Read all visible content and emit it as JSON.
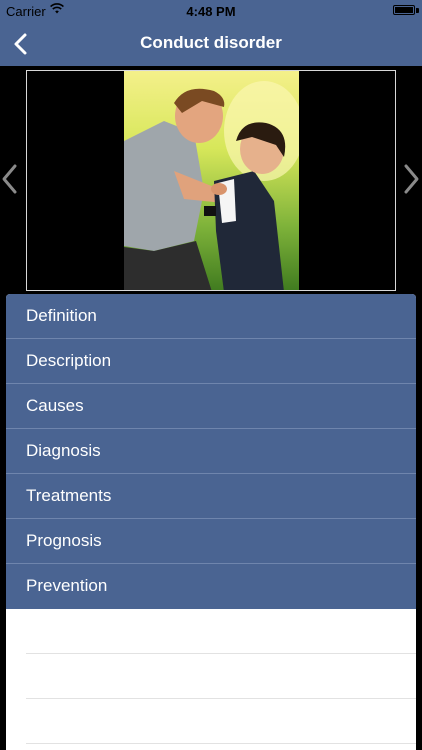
{
  "status_bar": {
    "carrier": "Carrier",
    "time": "4:48 PM",
    "battery_level": 1.0
  },
  "nav": {
    "title": "Conduct disorder",
    "back_icon": "chevron-left-icon"
  },
  "gallery": {
    "prev_icon": "chevron-left-icon",
    "next_icon": "chevron-right-icon"
  },
  "menu": {
    "items": [
      {
        "label": "Definition"
      },
      {
        "label": "Description"
      },
      {
        "label": "Causes"
      },
      {
        "label": "Diagnosis"
      },
      {
        "label": "Treatments"
      },
      {
        "label": "Prognosis"
      },
      {
        "label": "Prevention"
      }
    ]
  },
  "colors": {
    "nav_background": "#4a6492",
    "menu_background": "#4a6492",
    "menu_separator": "#6f85ad",
    "screen_background": "#000000"
  }
}
